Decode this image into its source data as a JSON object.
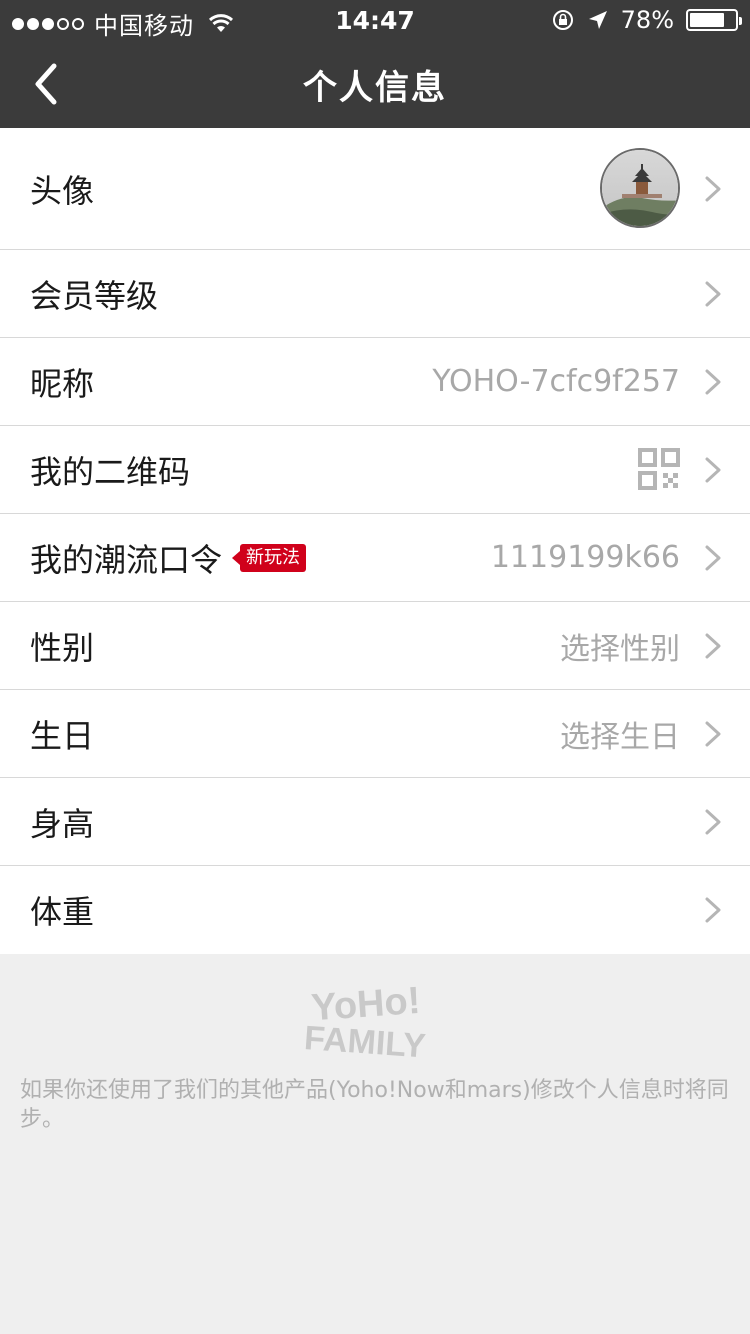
{
  "status_bar": {
    "carrier": "中国移动",
    "time": "14:47",
    "battery": "78%",
    "battery_level": 0.78,
    "signal_strength": 3,
    "signal_max": 5
  },
  "nav": {
    "title": "个人信息",
    "back_icon": "chevron-left-icon"
  },
  "rows": [
    {
      "label": "头像",
      "value": "",
      "type": "avatar"
    },
    {
      "label": "会员等级",
      "value": ""
    },
    {
      "label": "昵称",
      "value": "YOHO-7cfc9f257"
    },
    {
      "label": "我的二维码",
      "value": "",
      "type": "qrcode"
    },
    {
      "label": "我的潮流口令",
      "badge": "新玩法",
      "value": "1119199k66"
    },
    {
      "label": "性别",
      "value": "选择性别"
    },
    {
      "label": "生日",
      "value": "选择生日"
    },
    {
      "label": "身高",
      "value": ""
    },
    {
      "label": "体重",
      "value": ""
    }
  ],
  "footer": {
    "logo_text": "YOHO! FAMILY",
    "note": "如果你还使用了我们的其他产品(Yoho!Now和mars)修改个人信息时将同步。"
  },
  "colors": {
    "header_bg": "#3b3b3b",
    "badge_red": "#d0011b",
    "value_gray": "#a8a8a8",
    "footer_bg": "#efefef"
  }
}
